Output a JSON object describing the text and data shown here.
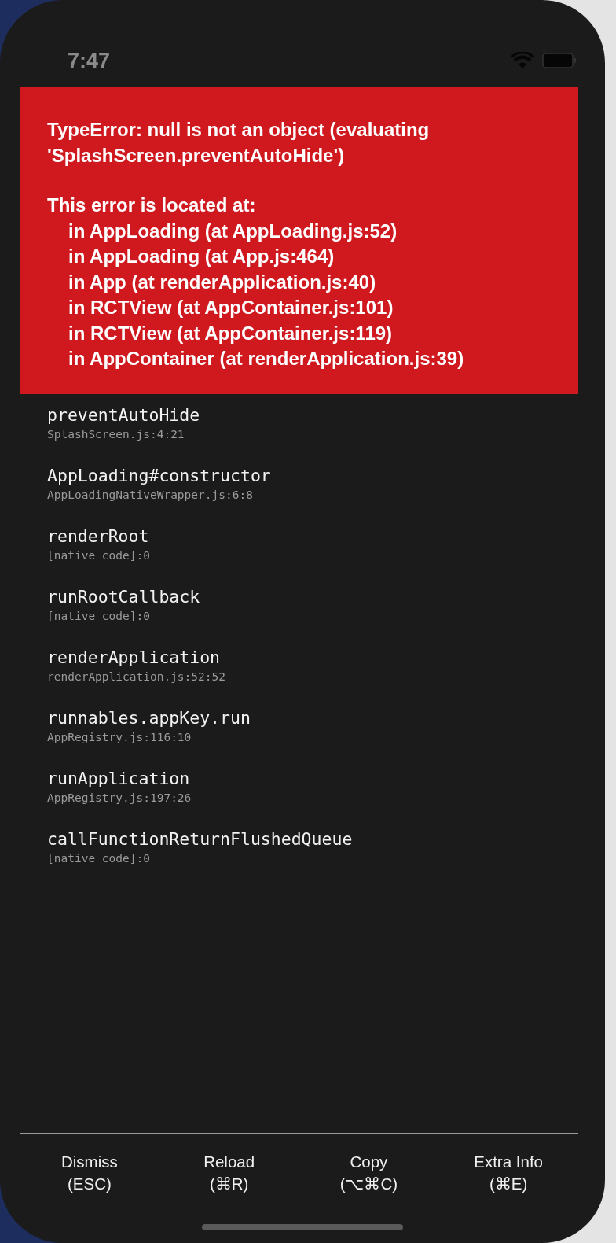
{
  "status_bar": {
    "time": "7:47"
  },
  "error": {
    "message": "TypeError: null is not an object (evaluating 'SplashScreen.preventAutoHide')",
    "location_heading": "This error is located at:",
    "locations": [
      "in AppLoading (at AppLoading.js:52)",
      "in AppLoading (at App.js:464)",
      "in App (at renderApplication.js:40)",
      "in RCTView (at AppContainer.js:101)",
      "in RCTView (at AppContainer.js:119)",
      "in AppContainer (at renderApplication.js:39)"
    ]
  },
  "stack": [
    {
      "method": "preventAutoHide",
      "file": "SplashScreen.js:4:21"
    },
    {
      "method": "AppLoading#constructor",
      "file": "AppLoadingNativeWrapper.js:6:8"
    },
    {
      "method": "renderRoot",
      "file": "[native code]:0"
    },
    {
      "method": "runRootCallback",
      "file": "[native code]:0"
    },
    {
      "method": "renderApplication",
      "file": "renderApplication.js:52:52"
    },
    {
      "method": "runnables.appKey.run",
      "file": "AppRegistry.js:116:10"
    },
    {
      "method": "runApplication",
      "file": "AppRegistry.js:197:26"
    },
    {
      "method": "callFunctionReturnFlushedQueue",
      "file": "[native code]:0"
    }
  ],
  "buttons": [
    {
      "label": "Dismiss",
      "shortcut": "(ESC)"
    },
    {
      "label": "Reload",
      "shortcut": "(⌘R)"
    },
    {
      "label": "Copy",
      "shortcut": "(⌥⌘C)"
    },
    {
      "label": "Extra Info",
      "shortcut": "(⌘E)"
    }
  ]
}
